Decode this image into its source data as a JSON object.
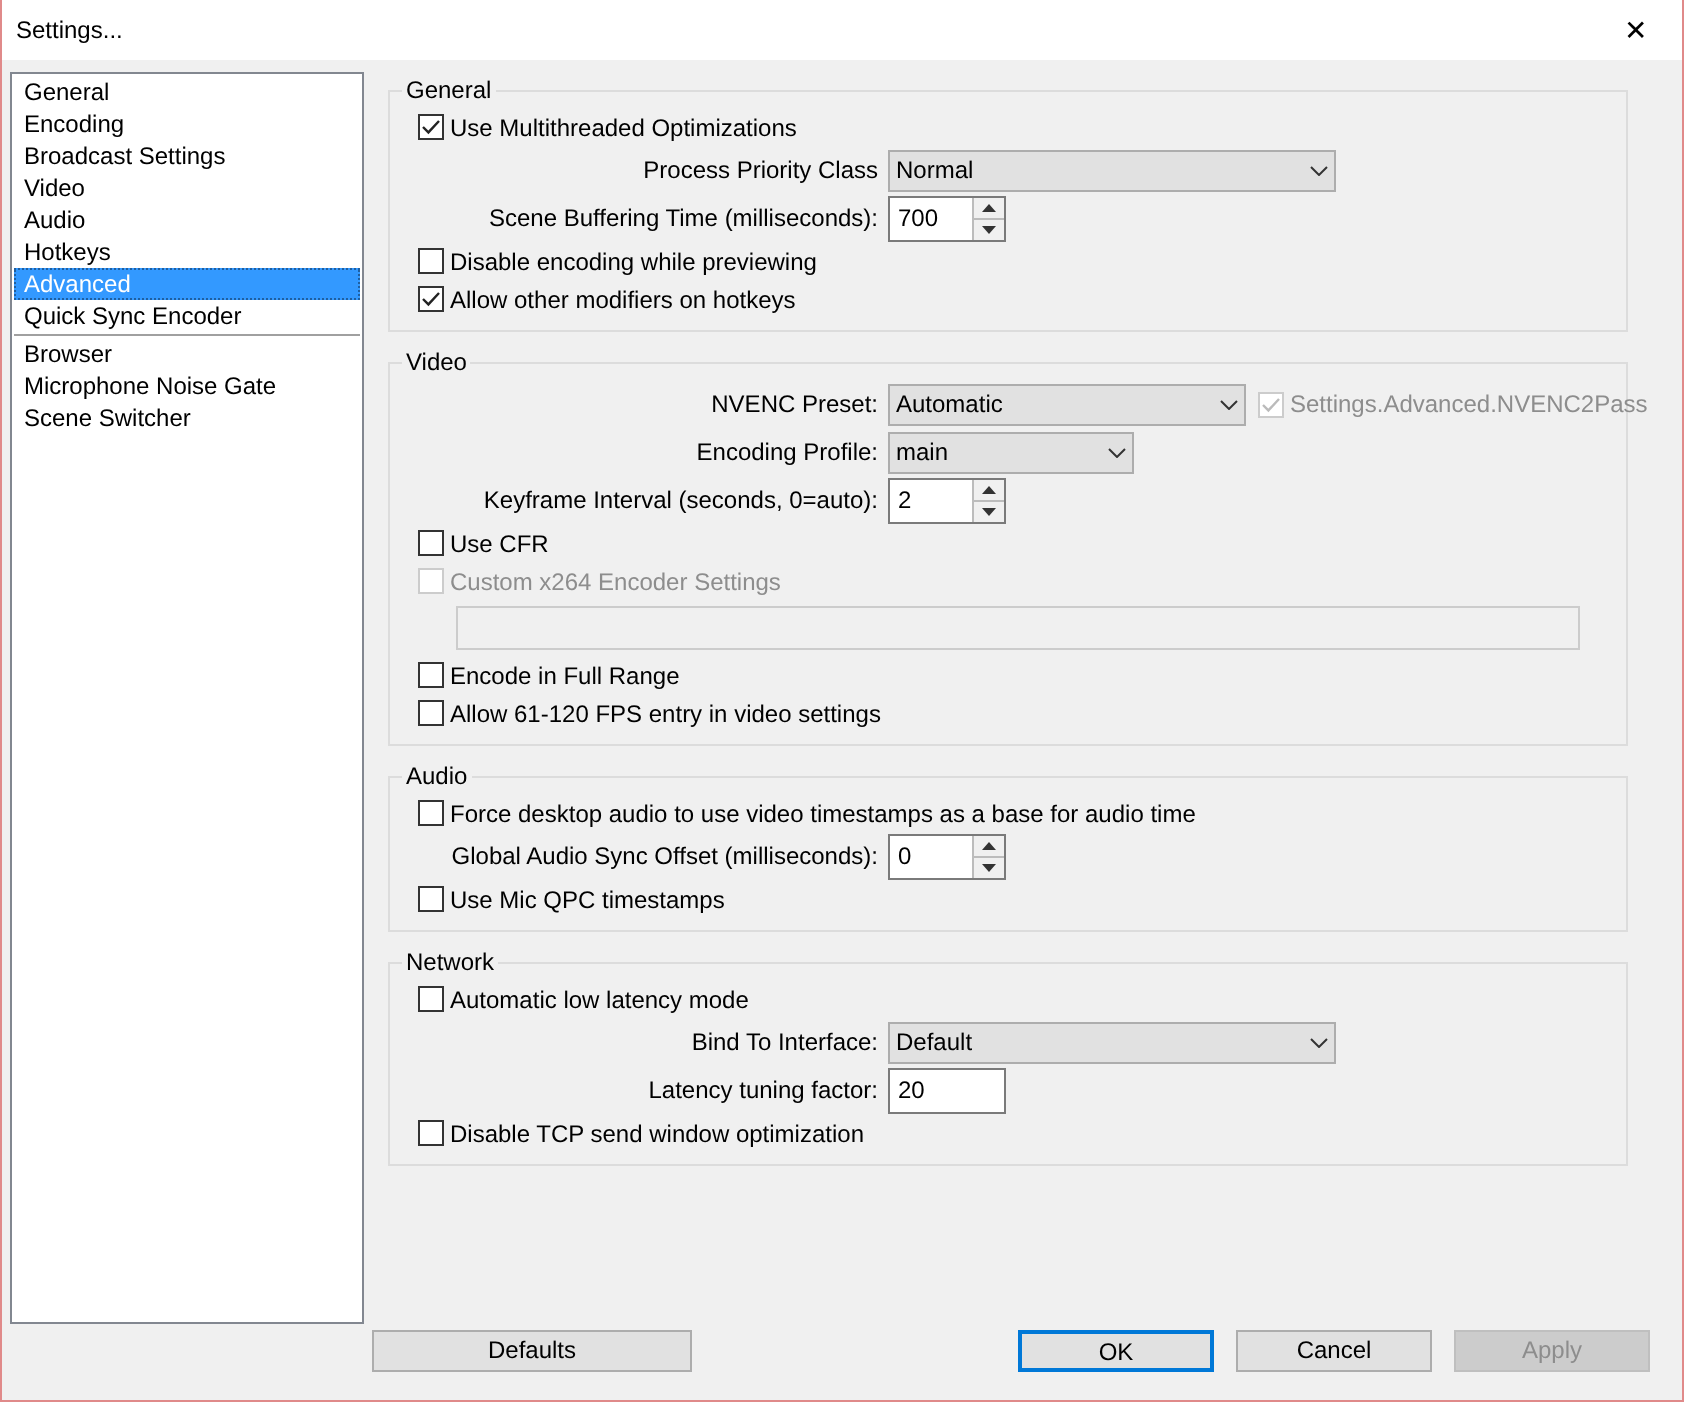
{
  "window": {
    "title": "Settings...",
    "close": "✕"
  },
  "sidebar": {
    "groups": [
      {
        "items": [
          {
            "label": "General",
            "selected": false
          },
          {
            "label": "Encoding",
            "selected": false
          },
          {
            "label": "Broadcast Settings",
            "selected": false
          },
          {
            "label": "Video",
            "selected": false
          },
          {
            "label": "Audio",
            "selected": false
          },
          {
            "label": "Hotkeys",
            "selected": false
          },
          {
            "label": "Advanced",
            "selected": true
          },
          {
            "label": "Quick Sync Encoder",
            "selected": false
          }
        ]
      },
      {
        "items": [
          {
            "label": "Browser",
            "selected": false
          },
          {
            "label": "Microphone Noise Gate",
            "selected": false
          },
          {
            "label": "Scene Switcher",
            "selected": false
          }
        ]
      }
    ]
  },
  "sections": [
    {
      "title": "General",
      "rows": [
        {
          "kind": "checkbox",
          "label": "Use Multithreaded Optimizations",
          "checked": true,
          "disabled": false
        },
        {
          "kind": "dropdown",
          "label": "Process Priority Class",
          "value": "Normal"
        },
        {
          "kind": "spin",
          "label": "Scene Buffering Time (milliseconds):",
          "value": "700"
        },
        {
          "kind": "checkbox",
          "label": "Disable encoding while previewing",
          "checked": false,
          "disabled": false
        },
        {
          "kind": "checkbox",
          "label": "Allow other modifiers on hotkeys",
          "checked": true,
          "disabled": false
        }
      ]
    },
    {
      "title": "Video",
      "rows": [
        {
          "kind": "dropdown",
          "label": "NVENC Preset:",
          "value": "Automatic",
          "side_checkbox": {
            "label": "Settings.Advanced.NVENC2Pass",
            "checked": true,
            "disabled": true
          }
        },
        {
          "kind": "dropdown",
          "label": "Encoding Profile:",
          "value": "main"
        },
        {
          "kind": "spin",
          "label": "Keyframe Interval (seconds, 0=auto):",
          "value": "2"
        },
        {
          "kind": "checkbox",
          "label": "Use CFR",
          "checked": false,
          "disabled": false
        },
        {
          "kind": "checkbox",
          "label": "Custom x264 Encoder Settings",
          "checked": false,
          "disabled": true
        },
        {
          "kind": "textbox",
          "disabled": true
        },
        {
          "kind": "checkbox",
          "label": "Encode in Full Range",
          "checked": false,
          "disabled": false
        },
        {
          "kind": "checkbox",
          "label": "Allow 61-120 FPS entry in video settings",
          "checked": false,
          "disabled": false
        }
      ]
    },
    {
      "title": "Audio",
      "rows": [
        {
          "kind": "checkbox",
          "label": "Force desktop audio to use video timestamps as a base for audio time",
          "checked": false,
          "disabled": false
        },
        {
          "kind": "spin",
          "label": "Global Audio Sync Offset (milliseconds):",
          "value": "0"
        },
        {
          "kind": "checkbox",
          "label": "Use Mic QPC timestamps",
          "checked": false,
          "disabled": false
        }
      ]
    },
    {
      "title": "Network",
      "rows": [
        {
          "kind": "checkbox",
          "label": "Automatic low latency mode",
          "checked": false,
          "disabled": false
        },
        {
          "kind": "dropdown",
          "label": "Bind To Interface:",
          "value": "Default"
        },
        {
          "kind": "text",
          "label": "Latency tuning factor:",
          "value": "20"
        },
        {
          "kind": "checkbox",
          "label": "Disable TCP send window optimization",
          "checked": false,
          "disabled": false
        }
      ]
    }
  ],
  "buttons": [
    {
      "label": "Defaults",
      "kind": "wide",
      "focused": false,
      "disabled": false
    },
    {
      "label": "OK",
      "kind": "normal",
      "focused": true,
      "disabled": false
    },
    {
      "label": "Cancel",
      "kind": "normal",
      "focused": false,
      "disabled": false
    },
    {
      "label": "Apply",
      "kind": "normal",
      "focused": false,
      "disabled": true
    }
  ]
}
